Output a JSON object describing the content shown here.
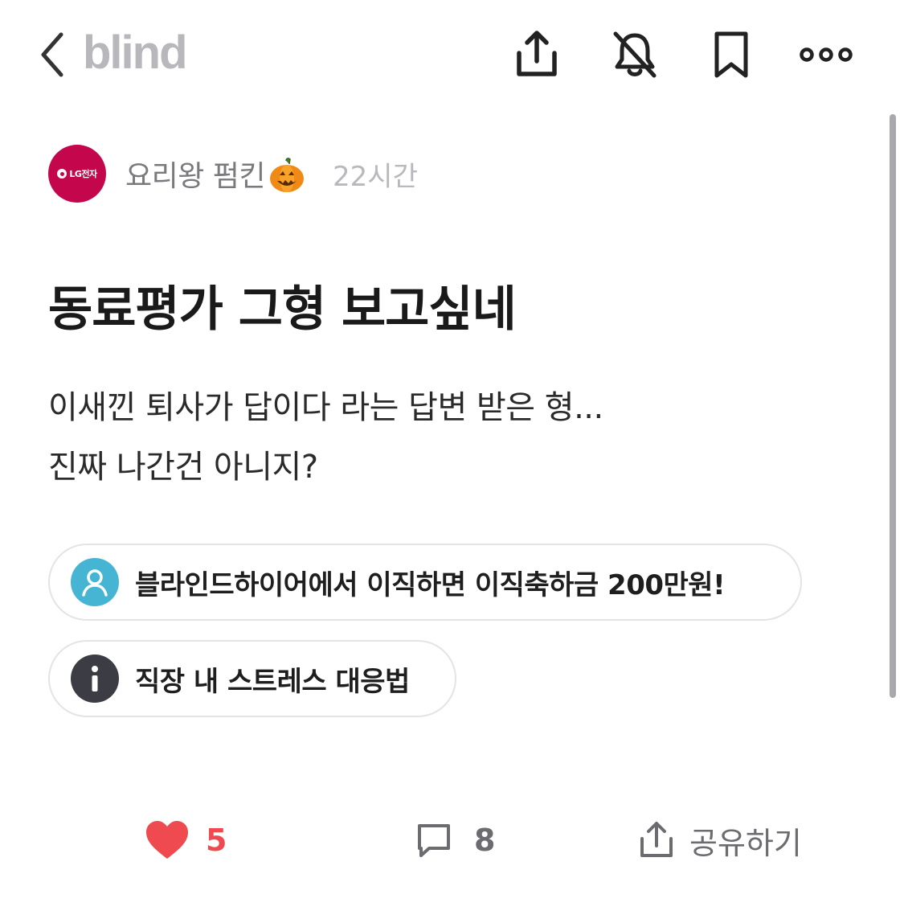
{
  "header": {
    "logo": "blind",
    "icons": [
      "back-icon",
      "share-icon",
      "bell-off-icon",
      "bookmark-icon",
      "more-icon"
    ]
  },
  "author": {
    "company_logo_text": "LG전자",
    "nickname": "요리왕 펌킨",
    "emoji": "pumpkin-icon",
    "time": "22시간",
    "avatar_color": "#c4074c"
  },
  "post": {
    "title": "동료평가 그형 보고싶네",
    "body_lines": [
      "이새낀 퇴사가 답이다 라는 답변 받은 형...",
      "진짜 나간건 아니지?"
    ]
  },
  "links": [
    {
      "label": "블라인드하이어에서 이직하면 이직축하금 200만원!",
      "icon": "user-icon",
      "icon_color": "#46b4d3"
    },
    {
      "label": "직장 내 스트레스 대응법",
      "icon": "info-icon",
      "icon_color": "#3c3c44"
    }
  ],
  "actions": {
    "likes": "5",
    "comments": "8",
    "share_label": "공유하기",
    "like_color": "#ef4a4f"
  }
}
